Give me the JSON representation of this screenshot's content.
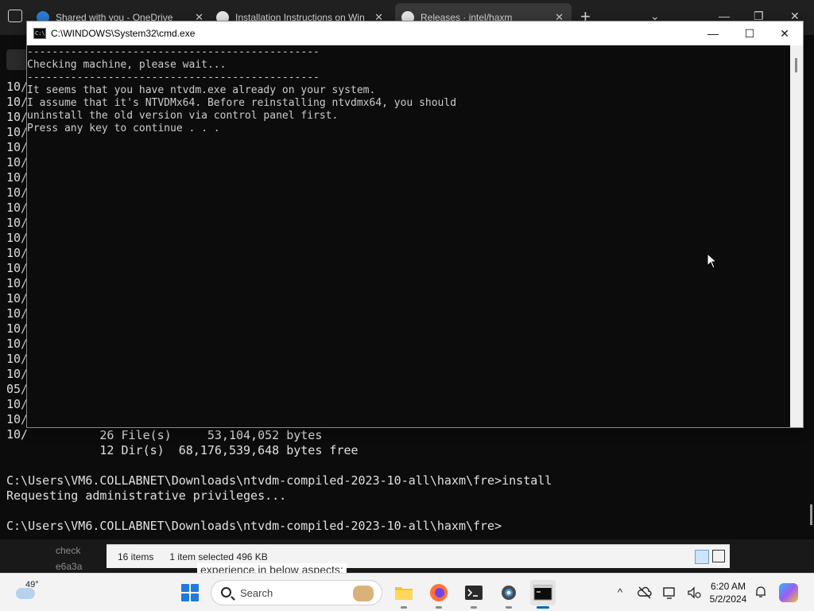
{
  "browser": {
    "tabs": [
      {
        "title": "Shared with you - OneDrive",
        "icon": "onedrive-icon"
      },
      {
        "title": "Installation Instructions on Win",
        "icon": "github-icon"
      },
      {
        "title": "Releases · intel/haxm",
        "icon": "github-icon",
        "active": true
      }
    ],
    "new_tab_glyph": "+",
    "tab_list_glyph": "⌄",
    "minimize_glyph": "—",
    "restore_glyph": "❐",
    "close_glyph": "✕"
  },
  "terminal": {
    "date_prefixes": [
      "10/",
      "10/",
      "10/",
      "10/",
      "10/",
      "10/",
      "10/",
      "10/",
      "10/",
      "10/",
      "10/",
      "10/",
      "10/",
      "10/",
      "10/",
      "10/",
      "10/",
      "10/",
      "10/",
      "10/",
      "05/",
      "10/",
      "10/",
      "10/"
    ],
    "lines": [
      "             26 File(s)     53,104,052 bytes",
      "             12 Dir(s)  68,176,539,648 bytes free",
      "",
      "C:\\Users\\VM6.COLLABNET\\Downloads\\ntvdm-compiled-2023-10-all\\haxm\\fre>install",
      "Requesting administrative privileges...",
      "",
      "C:\\Users\\VM6.COLLABNET\\Downloads\\ntvdm-compiled-2023-10-all\\haxm\\fre>"
    ]
  },
  "cmd_window": {
    "title": "C:\\WINDOWS\\System32\\cmd.exe",
    "icon_text": "C:\\.",
    "minimize_glyph": "—",
    "maximize_glyph": "☐",
    "close_glyph": "✕",
    "lines": [
      "-----------------------------------------------",
      "Checking machine, please wait...",
      "-----------------------------------------------",
      "It seems that you have ntvdm.exe already on your system.",
      "I assume that it's NTVDMx64. Before reinstalling ntvdmx64, you should",
      "uninstall the old version via control panel first.",
      "Press any key to continue . . ."
    ]
  },
  "explorer": {
    "left_lines": [
      "check",
      "e6a3a"
    ],
    "item_count": "16 items",
    "selected": "1 item selected  496 KB",
    "behind_text": "experience in below aspects:"
  },
  "taskbar": {
    "temperature": "49°",
    "search_placeholder": "Search",
    "time": "6:20 AM",
    "date": "5/2/2024",
    "apps": [
      "file-explorer",
      "firefox",
      "terminal",
      "settings",
      "cmd"
    ],
    "tray_glyphs": {
      "chevron": "^",
      "bell": "🔔"
    }
  }
}
